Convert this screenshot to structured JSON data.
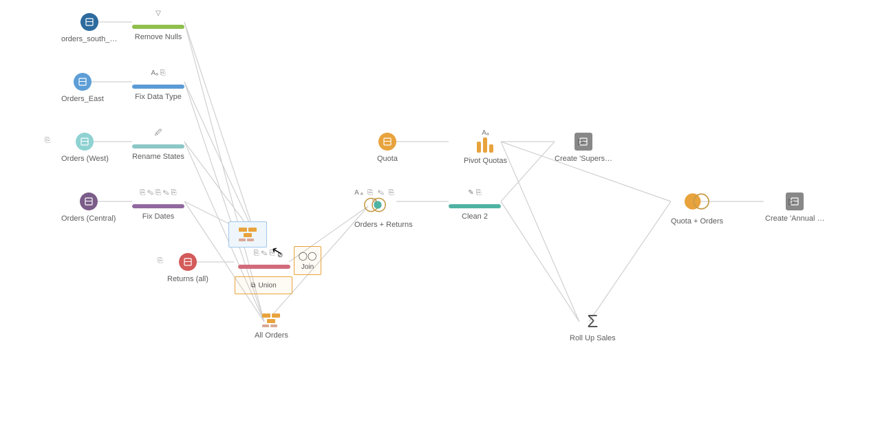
{
  "inputs": {
    "south": {
      "label": "orders_south_…"
    },
    "east": {
      "label": "Orders_East"
    },
    "west": {
      "label": "Orders (West)"
    },
    "central": {
      "label": "Orders (Central)"
    },
    "returns": {
      "label": "Returns (all)"
    },
    "quota": {
      "label": "Quota"
    }
  },
  "clean": {
    "remove_nulls": {
      "label": "Remove Nulls",
      "icons": "▽"
    },
    "fix_data_type": {
      "label": "Fix Data Type",
      "icons": "Aₐ ⎘"
    },
    "rename_states": {
      "label": "Rename States",
      "icons": "🖉"
    },
    "fix_dates": {
      "label": "Fix Dates",
      "icons": "⎘ ✎ ⎘ ✎ ⎘"
    },
    "clean2": {
      "label": "Clean 2",
      "icons": "✎ ⎘"
    }
  },
  "steps": {
    "pivot": {
      "label": "Pivot Quotas",
      "icons": "Aₐ"
    },
    "orders_returns": {
      "label": "Orders + Returns",
      "icons": "Aₐ ⎘ ✎ ⎘ ▽"
    },
    "all_orders": {
      "label": "All Orders"
    },
    "rollup": {
      "label": "Roll Up Sales"
    },
    "quota_orders": {
      "label": "Quota + Orders"
    }
  },
  "outputs": {
    "supers": {
      "label": "Create 'Supers…"
    },
    "annual": {
      "label": "Create 'Annual …"
    }
  },
  "drag": {
    "union_label": "Union",
    "join_label": "Join",
    "hidden_row_icons": "⎘ ✎ ⎘"
  }
}
